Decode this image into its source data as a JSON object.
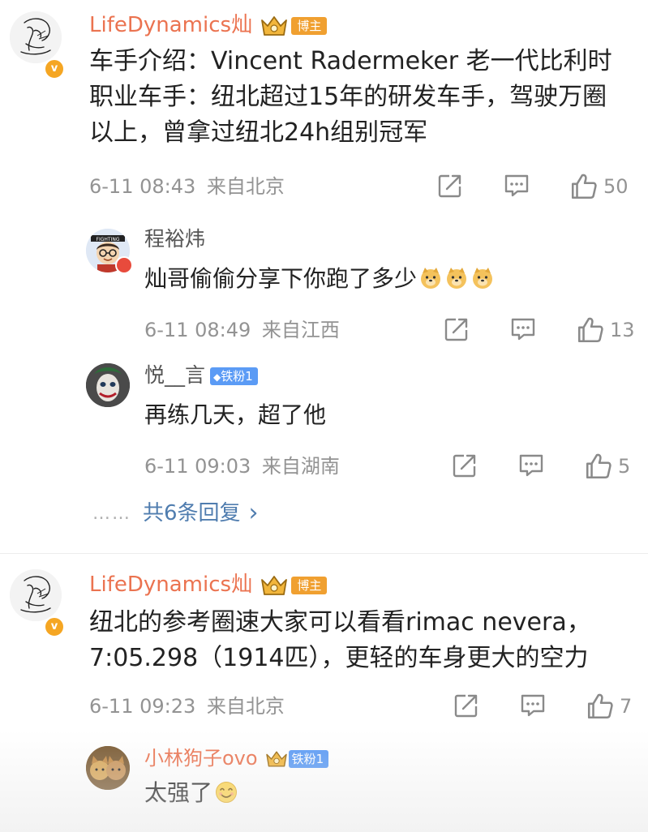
{
  "comments": [
    {
      "username": "LifeDynamics灿",
      "badge": "博主",
      "text_lines": [
        "车手介绍：Vincent Radermeker 老一代比利时",
        "职业车手：纽北超过15年的研发车手，驾驶万圈",
        "以上，曾拿过纽北24h组别冠军"
      ],
      "time": "6-11 08:43",
      "location": "来自北京",
      "likes": "50",
      "replies": [
        {
          "username": "程裕炜",
          "text": "灿哥偷偷分享下你跑了多少",
          "time": "6-11 08:49",
          "location": "来自江西",
          "likes": "13"
        },
        {
          "username": "悦__言",
          "fan_badge": "铁粉1",
          "text": "再练几天，超了他",
          "time": "6-11 09:03",
          "location": "来自湖南",
          "likes": "5"
        }
      ],
      "more_replies": "共6条回复"
    },
    {
      "username": "LifeDynamics灿",
      "badge": "博主",
      "text_lines": [
        "纽北的参考圈速大家可以看看rimac nevera，",
        "7:05.298（1914匹），更轻的车身更大的空力"
      ],
      "time": "6-11 09:23",
      "location": "来自北京",
      "likes": "7",
      "replies": [
        {
          "username": "小林狗子ovo",
          "fan_badge": "铁粉1",
          "text": "太强了"
        }
      ]
    }
  ],
  "icons": {
    "verified": "v",
    "ellipsis": "……",
    "chevron": "›",
    "crown": "crown-icon",
    "share": "share-icon",
    "comment": "comment-icon",
    "like": "like-icon",
    "emoji_dog": "doge-emoji",
    "emoji_smile": "smile-emoji"
  },
  "colors": {
    "username": "#eb7350",
    "meta": "#939393",
    "link": "#507daf",
    "badge_host": "#f0a030",
    "badge_fan": "#5b9bf5"
  }
}
